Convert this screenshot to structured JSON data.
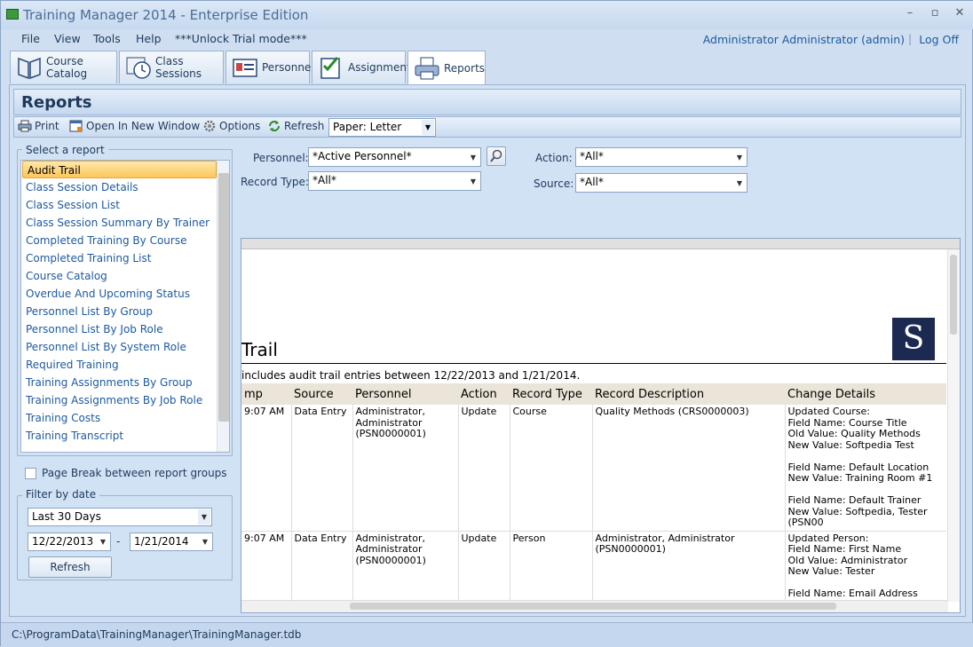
{
  "window": {
    "title": "Training Manager 2014 - Enterprise Edition",
    "minimize": "–",
    "maximize": "▫",
    "close": "✕"
  },
  "menu": {
    "items": [
      "File",
      "View",
      "Tools",
      "Help",
      "***Unlock Trial mode***"
    ],
    "user": "Administrator Administrator (admin)",
    "separator": "|",
    "logoff": "Log Off"
  },
  "tabs": [
    {
      "label": "Course Catalog",
      "icon": "book-icon"
    },
    {
      "label": "Class Sessions",
      "icon": "clock-icon"
    },
    {
      "label": "Personnel",
      "icon": "id-card-icon"
    },
    {
      "label": "Assignments",
      "icon": "checklist-icon"
    },
    {
      "label": "Reports",
      "icon": "printer-icon",
      "active": true
    }
  ],
  "reports": {
    "title": "Reports"
  },
  "toolbar": {
    "print": "Print",
    "open_new_window": "Open In New Window",
    "options": "Options",
    "refresh": "Refresh",
    "paper": "Paper: Letter"
  },
  "sidebar": {
    "select_title": "Select a report",
    "reports": [
      "Audit Trail",
      "Class Session Details",
      "Class Session List",
      "Class Session Summary By Trainer",
      "Completed Training By Course",
      "Completed Training List",
      "Course Catalog",
      "Overdue And Upcoming Status",
      "Personnel List By Group",
      "Personnel List By Job Role",
      "Personnel List By System Role",
      "Required Training",
      "Training Assignments By Group",
      "Training Assignments By Job Role",
      "Training Costs",
      "Training Transcript"
    ],
    "selected": "Audit Trail",
    "page_break": "Page Break between report groups",
    "filter_title": "Filter by date",
    "date_range": "Last 30 Days",
    "date_from": "12/22/2013",
    "date_dash": "-",
    "date_to": "1/21/2014",
    "refresh": "Refresh"
  },
  "filters": {
    "personnel_label": "Personnel:",
    "personnel_value": "*Active Personnel*",
    "record_type_label": "Record Type:",
    "record_type_value": "*All*",
    "action_label": "Action:",
    "action_value": "*All*",
    "source_label": "Source:",
    "source_value": "*All*"
  },
  "report": {
    "title": "Trail",
    "logo": "S",
    "subtitle": "includes audit trail entries between 12/22/2013 and 1/21/2014.",
    "columns": [
      "mp",
      "Source",
      "Personnel",
      "Action",
      "Record Type",
      "Record Description",
      "Change Details"
    ],
    "rows": [
      [
        "9:07 AM",
        "Data Entry",
        "Administrator,\nAdministrator\n(PSN0000001)",
        "Update",
        "Course",
        "Quality Methods (CRS0000003)",
        "Updated Course:\nField Name: Course Title\nOld Value: Quality Methods\nNew Value: Softpedia Test\n\nField Name: Default Location\nNew Value: Training Room #1\n\nField Name: Default Trainer\nNew Value: Softpedia, Tester (PSN00"
      ],
      [
        "9:07 AM",
        "Data Entry",
        "Administrator,\nAdministrator\n(PSN0000001)",
        "Update",
        "Person",
        "Administrator, Administrator (PSN0000001)",
        "Updated Person:\nField Name: First Name\nOld Value: Administrator\nNew Value: Tester\n\nField Name: Email Address\nOld Value: administrator@company.co"
      ]
    ]
  },
  "status": {
    "path": "C:\\ProgramData\\TrainingManager\\TrainingManager.tdb"
  }
}
